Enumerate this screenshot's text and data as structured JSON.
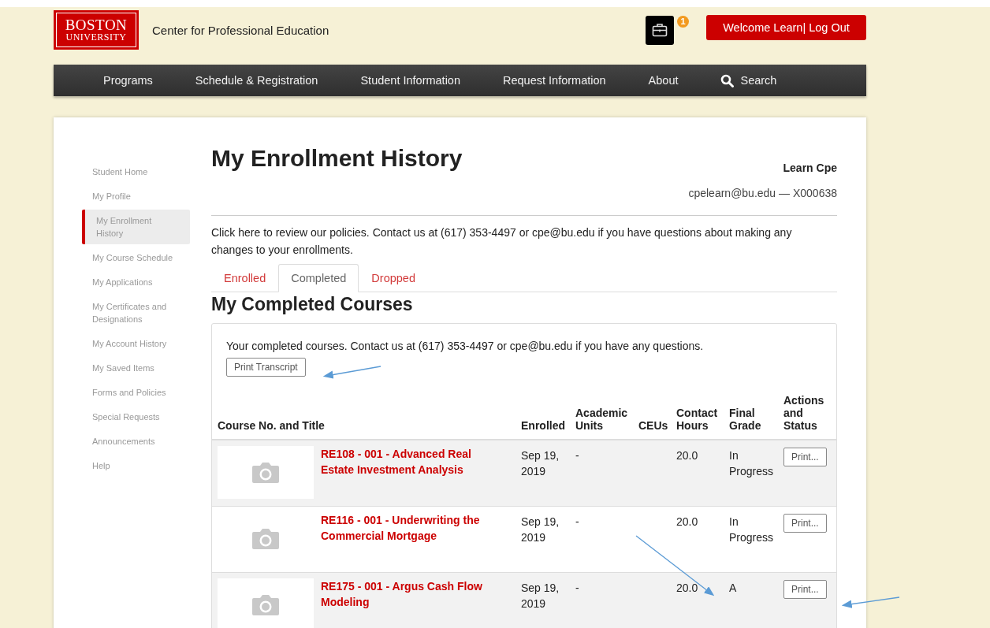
{
  "header": {
    "logo": {
      "line1": "BOSTON",
      "line2": "UNIVERSITY"
    },
    "site_title": "Center for Professional Education",
    "cart": {
      "badge": "1"
    },
    "account_button": "Welcome Learn| Log Out"
  },
  "nav": [
    {
      "label": "Programs",
      "kind": "link"
    },
    {
      "label": "Schedule & Registration",
      "kind": "link"
    },
    {
      "label": "Student Information",
      "kind": "link"
    },
    {
      "label": "Request Information",
      "kind": "link"
    },
    {
      "label": "About",
      "kind": "link"
    },
    {
      "label": "Search",
      "kind": "search"
    }
  ],
  "sidebar": {
    "items": [
      {
        "label": "Student Home",
        "selected": false
      },
      {
        "label": "My Profile",
        "selected": false
      },
      {
        "label": "My Enrollment History",
        "selected": true
      },
      {
        "label": "My Course Schedule",
        "selected": false
      },
      {
        "label": "My Applications",
        "selected": false
      },
      {
        "label": "My Certificates and Designations",
        "selected": false
      },
      {
        "label": "My Account History",
        "selected": false
      },
      {
        "label": "My Saved Items",
        "selected": false
      },
      {
        "label": "Forms and Policies",
        "selected": false
      },
      {
        "label": "Special Requests",
        "selected": false
      },
      {
        "label": "Announcements",
        "selected": false
      },
      {
        "label": "Help",
        "selected": false
      }
    ]
  },
  "page": {
    "title": "My Enrollment History",
    "user_name": "Learn Cpe",
    "user_contact": "cpelearn@bu.edu — X000638",
    "notice": "Click here to review our policies. Contact us at (617) 353-4497 or cpe@bu.edu if you have questions about making any changes to your enrollments."
  },
  "tabs": [
    {
      "label": "Enrolled",
      "selected": false
    },
    {
      "label": "Completed",
      "selected": true
    },
    {
      "label": "Dropped",
      "selected": false
    }
  ],
  "section": {
    "title": "My Completed Courses",
    "intro": "Your completed courses. Contact us at (617) 353-4497 or cpe@bu.edu if you have any questions.",
    "print_button": "Print Transcript"
  },
  "table": {
    "columns": [
      "Course No. and Title",
      "Enrolled",
      "Academic Units",
      "CEUs",
      "Contact Hours",
      "Final Grade",
      "Actions and Status"
    ],
    "rows": [
      {
        "course": "RE108 - 001 - Advanced Real Estate Investment Analysis",
        "enrolled": "Sep 19, 2019",
        "academic_units": "-",
        "contact_hours": "20.0",
        "final_grade": "In Progress",
        "action": "Print..."
      },
      {
        "course": "RE116 - 001 - Underwriting the Commercial Mortgage",
        "enrolled": "Sep 19, 2019",
        "academic_units": "-",
        "contact_hours": "20.0",
        "final_grade": "In Progress",
        "action": "Print..."
      },
      {
        "course": "RE175 - 001 - Argus Cash Flow Modeling",
        "enrolled": "Sep 19, 2019",
        "academic_units": "-",
        "contact_hours": "20.0",
        "final_grade": "A",
        "action": "Print..."
      }
    ]
  }
}
